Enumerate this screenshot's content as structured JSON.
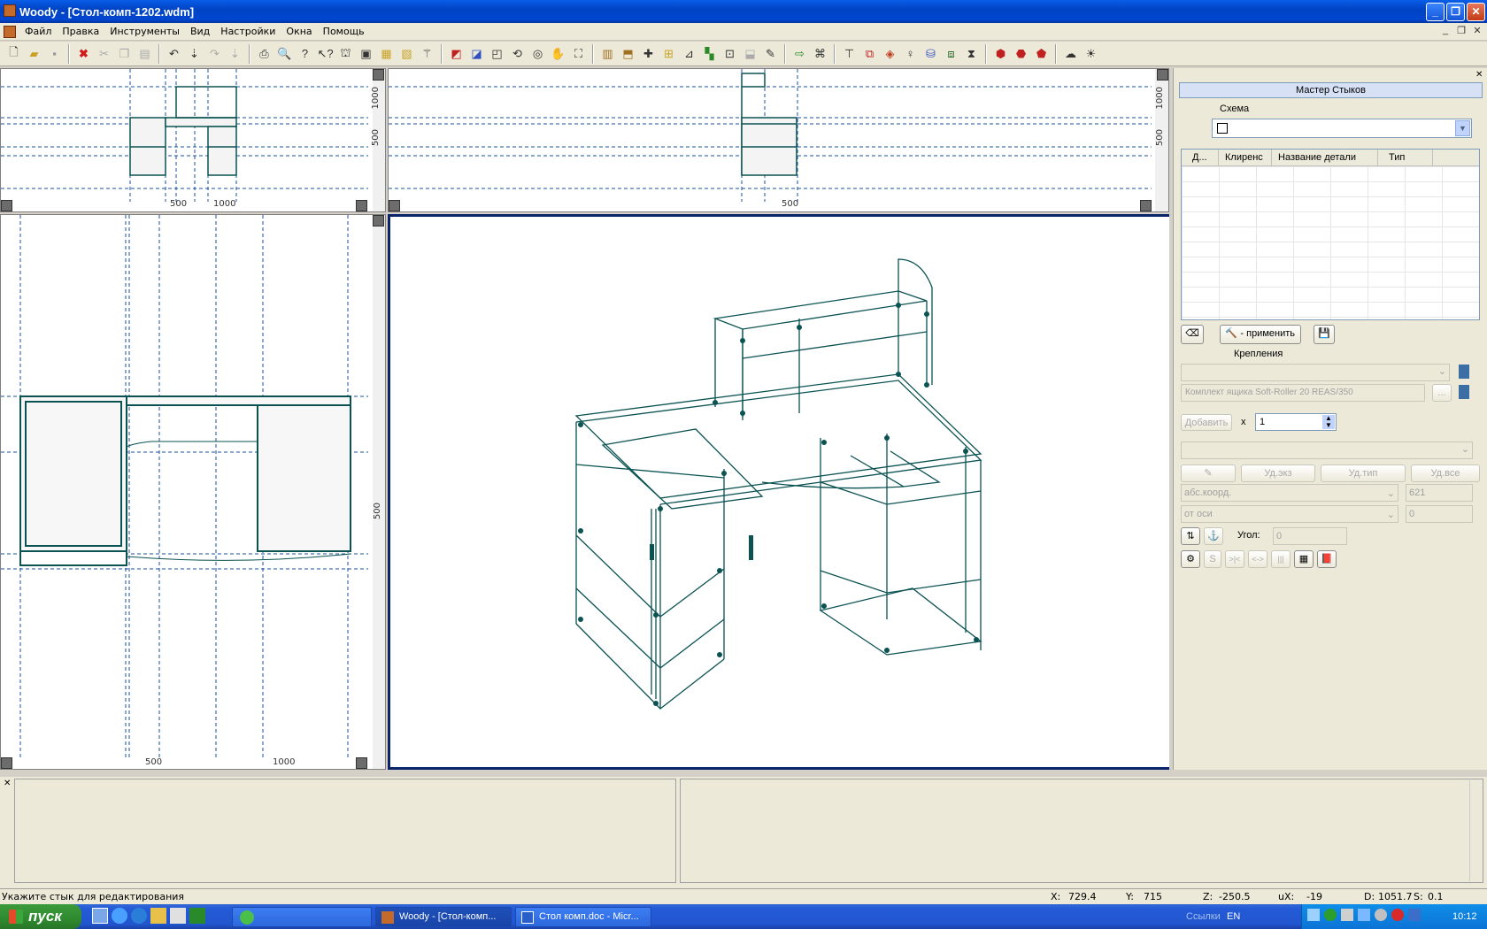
{
  "window": {
    "title": "Woody - [Стол-комп-1202.wdm]"
  },
  "menu": [
    "Файл",
    "Правка",
    "Инструменты",
    "Вид",
    "Настройки",
    "Окна",
    "Помощь"
  ],
  "viewports": {
    "front": {
      "ticks": [
        "500",
        "1000"
      ],
      "vlabels": [
        "1000",
        "500"
      ]
    },
    "side": {
      "ticks": [
        "500"
      ],
      "vlabels": [
        "1000",
        "500"
      ]
    },
    "top": {
      "ticks": [
        "500",
        "1000"
      ],
      "vlabels": [
        "500"
      ]
    }
  },
  "panel": {
    "header": "Мастер Стыков",
    "scheme_label": "Схема",
    "columns": [
      "Д...",
      "Клиренс",
      "Название детали",
      "Тип"
    ],
    "apply_label": "- применить",
    "fastenings_label": "Крепления",
    "fastening_value": "Комплект ящика Soft-Roller 20 REAS/350",
    "add_label": "Добавить",
    "times": "x",
    "count": "1",
    "del_exz": "Уд.экз",
    "del_type": "Уд.тип",
    "del_all": "Уд.все",
    "coord_mode": "абс.коорд.",
    "coord_value": "621",
    "axis_mode": "от оси",
    "axis_value": "0",
    "angle_label": "Угол:",
    "angle_value": "0",
    "mini_buttons": [
      "S",
      ">|<",
      "<->",
      "|||"
    ]
  },
  "status": {
    "message": "Укажите стык для редактирования",
    "x_label": "X:",
    "x": "729.4",
    "y_label": "Y:",
    "y": "715",
    "z_label": "Z:",
    "z": "-250.5",
    "ux_label": "uX:",
    "ux": "-19",
    "d_label": "D:",
    "d": "1051.7",
    "s_label": "S:",
    "s": "0.1"
  },
  "taskbar": {
    "start": "пуск",
    "tasks": [
      "Woody - [Стол-комп...",
      "Стол комп.doc - Micr..."
    ],
    "links": "Ссылки",
    "lang": "EN",
    "clock": "10:12"
  },
  "colors": {
    "accent": "#0a246a",
    "model": "#0b5252",
    "guide": "#1a4fa0"
  }
}
